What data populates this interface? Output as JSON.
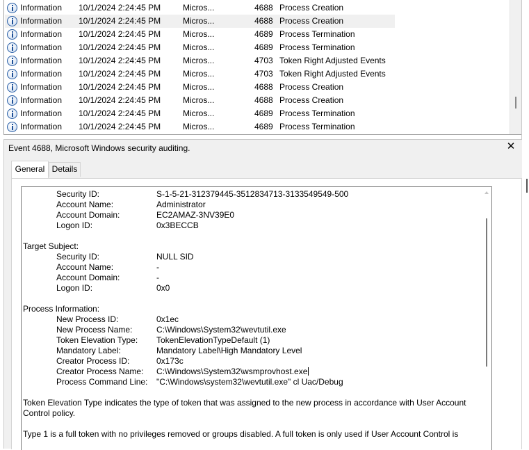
{
  "event_list": {
    "rows": [
      {
        "level": "Information",
        "date": "10/1/2024 2:24:45 PM",
        "source": "Micros...",
        "event_id": "4688",
        "task": "Process Creation",
        "selected": false
      },
      {
        "level": "Information",
        "date": "10/1/2024 2:24:45 PM",
        "source": "Micros...",
        "event_id": "4688",
        "task": "Process Creation",
        "selected": true
      },
      {
        "level": "Information",
        "date": "10/1/2024 2:24:45 PM",
        "source": "Micros...",
        "event_id": "4689",
        "task": "Process Termination",
        "selected": false
      },
      {
        "level": "Information",
        "date": "10/1/2024 2:24:45 PM",
        "source": "Micros...",
        "event_id": "4689",
        "task": "Process Termination",
        "selected": false
      },
      {
        "level": "Information",
        "date": "10/1/2024 2:24:45 PM",
        "source": "Micros...",
        "event_id": "4703",
        "task": "Token Right Adjusted Events",
        "selected": false
      },
      {
        "level": "Information",
        "date": "10/1/2024 2:24:45 PM",
        "source": "Micros...",
        "event_id": "4703",
        "task": "Token Right Adjusted Events",
        "selected": false
      },
      {
        "level": "Information",
        "date": "10/1/2024 2:24:45 PM",
        "source": "Micros...",
        "event_id": "4688",
        "task": "Process Creation",
        "selected": false
      },
      {
        "level": "Information",
        "date": "10/1/2024 2:24:45 PM",
        "source": "Micros...",
        "event_id": "4688",
        "task": "Process Creation",
        "selected": false
      },
      {
        "level": "Information",
        "date": "10/1/2024 2:24:45 PM",
        "source": "Micros...",
        "event_id": "4689",
        "task": "Process Termination",
        "selected": false
      },
      {
        "level": "Information",
        "date": "10/1/2024 2:24:45 PM",
        "source": "Micros...",
        "event_id": "4689",
        "task": "Process Termination",
        "selected": false
      }
    ],
    "icon": "info-icon"
  },
  "detail": {
    "title": "Event 4688, Microsoft Windows security auditing.",
    "close_icon": "✕",
    "tabs": {
      "general": "General",
      "details": "Details"
    }
  },
  "general_text": {
    "subject_security_id_label": "Security ID:",
    "subject_security_id": "S-1-5-21-312379445-3512834713-3133549549-500",
    "subject_account_name_label": "Account Name:",
    "subject_account_name": "Administrator",
    "subject_account_domain_label": "Account Domain:",
    "subject_account_domain": "EC2AMAZ-3NV39E0",
    "subject_logon_id_label": "Logon ID:",
    "subject_logon_id": "0x3BECCB",
    "target_header": "Target Subject:",
    "target_security_id_label": "Security ID:",
    "target_security_id": "NULL SID",
    "target_account_name_label": "Account Name:",
    "target_account_name": "-",
    "target_account_domain_label": "Account Domain:",
    "target_account_domain": "-",
    "target_logon_id_label": "Logon ID:",
    "target_logon_id": "0x0",
    "process_header": "Process Information:",
    "new_process_id_label": "New Process ID:",
    "new_process_id": "0x1ec",
    "new_process_name_label": "New Process Name:",
    "new_process_name": "C:\\Windows\\System32\\wevtutil.exe",
    "token_elevation_type_label": "Token Elevation Type:",
    "token_elevation_type": "TokenElevationTypeDefault (1)",
    "mandatory_label_label": "Mandatory Label:",
    "mandatory_label": "Mandatory Label\\High Mandatory Level",
    "creator_process_id_label": "Creator Process ID:",
    "creator_process_id": "0x173c",
    "creator_process_name_label": "Creator Process Name:",
    "creator_process_name": "C:\\Windows\\System32\\wsmprovhost.exe",
    "process_command_line_label": "Process Command Line:",
    "process_command_line": "\"C:\\Windows\\system32\\wevtutil.exe\" cl Uac/Debug",
    "para1_line1": "Token Elevation Type indicates the type of token that was assigned to the new process in accordance with User Account",
    "para1_line2": "Control policy.",
    "para2_line1": "Type 1 is a full token with no privileges removed or groups disabled.  A full token is only used if User Account Control is"
  }
}
